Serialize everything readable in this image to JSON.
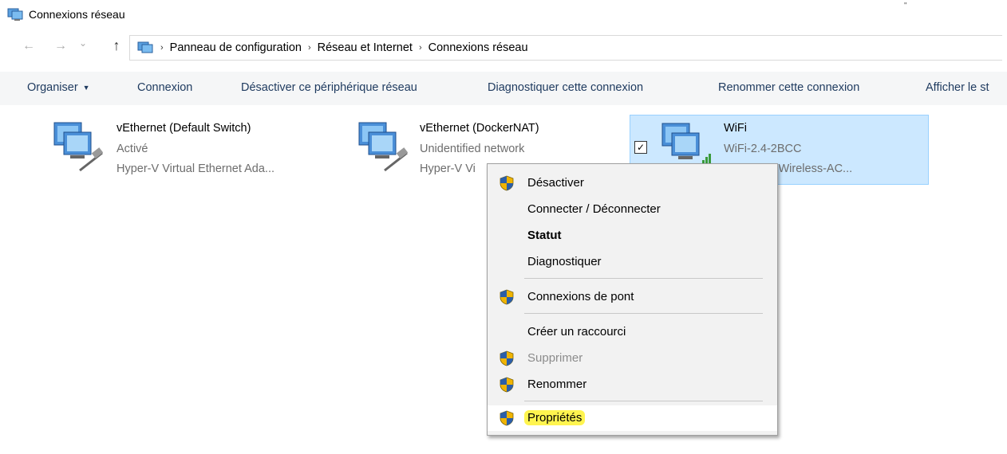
{
  "window": {
    "title": "Connexions réseau",
    "corner_mark": "\""
  },
  "address": {
    "crumbs": [
      "Panneau de configuration",
      "Réseau et Internet",
      "Connexions réseau"
    ],
    "separator": "›",
    "back_glyph": "←",
    "forward_glyph": "→",
    "recent_glyph": "⌄",
    "up_glyph": "↑"
  },
  "toolbar": {
    "organize": "Organiser",
    "connect": "Connexion",
    "disable": "Désactiver ce périphérique réseau",
    "diagnose": "Diagnostiquer cette connexion",
    "rename": "Renommer cette connexion",
    "view_status": "Afficher le st"
  },
  "connections": [
    {
      "name": "vEthernet (Default Switch)",
      "status": "Activé",
      "adapter": "Hyper-V Virtual Ethernet Ada...",
      "icon": "ethernet-adapter-icon"
    },
    {
      "name": "vEthernet (DockerNAT)",
      "status": "Unidentified network",
      "adapter": "Hyper-V Vi",
      "icon": "ethernet-adapter-icon"
    },
    {
      "name": "WiFi",
      "status": "WiFi-2.4-2BCC",
      "adapter": "AVASTAR Wireless-AC...",
      "icon": "wifi-adapter-icon",
      "selected": true,
      "checked": "✓"
    }
  ],
  "context_menu": {
    "items": [
      {
        "label": "Désactiver",
        "shield": true
      },
      {
        "label": "Connecter / Déconnecter",
        "shield": false
      },
      {
        "label": "Statut",
        "shield": false,
        "bold": true
      },
      {
        "label": "Diagnostiquer",
        "shield": false
      },
      {
        "label": "Connexions de pont",
        "shield": true
      },
      {
        "label": "Créer un raccourci",
        "shield": false
      },
      {
        "label": "Supprimer",
        "shield": true,
        "disabled": true
      },
      {
        "label": "Renommer",
        "shield": true
      },
      {
        "label": "Propriétés",
        "shield": true,
        "highlighted": true
      }
    ]
  },
  "colors": {
    "selection_bg": "#cce8ff",
    "selection_border": "#99d1ff",
    "highlight": "#fff44f",
    "toolbar_bg": "#f5f6f7"
  }
}
